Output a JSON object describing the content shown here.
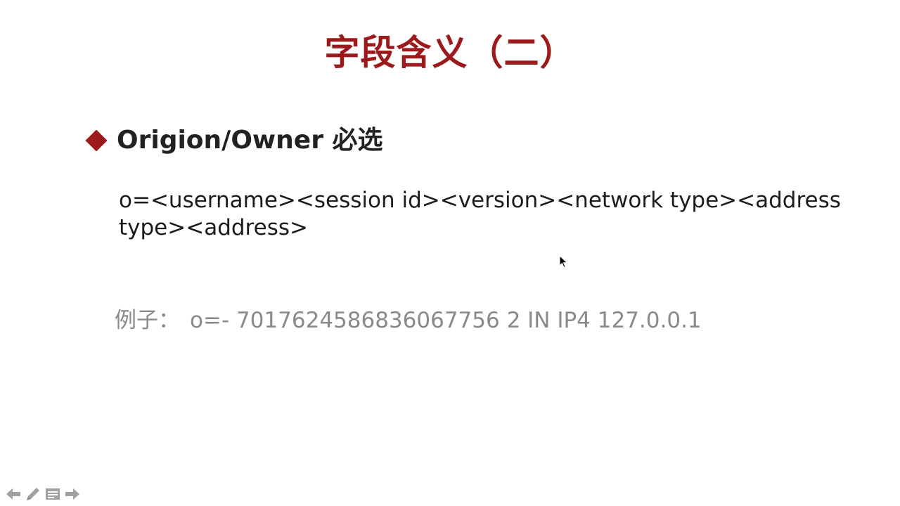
{
  "slide": {
    "title": "字段含义（二）",
    "bullet": "Origion/Owner 必选",
    "syntax": "o=<username><session id><version><network type><address type><address>",
    "example_label": "例子：",
    "example_value": "o=- 7017624586836067756 2 IN IP4 127.0.0.1"
  },
  "nav": {
    "icons": [
      "arrow-left-icon",
      "pen-icon",
      "menu-icon",
      "arrow-right-icon"
    ]
  },
  "colors": {
    "accent": "#9c1a1c",
    "body_text": "#1c1c1c",
    "example_text": "#8a8a8a"
  }
}
